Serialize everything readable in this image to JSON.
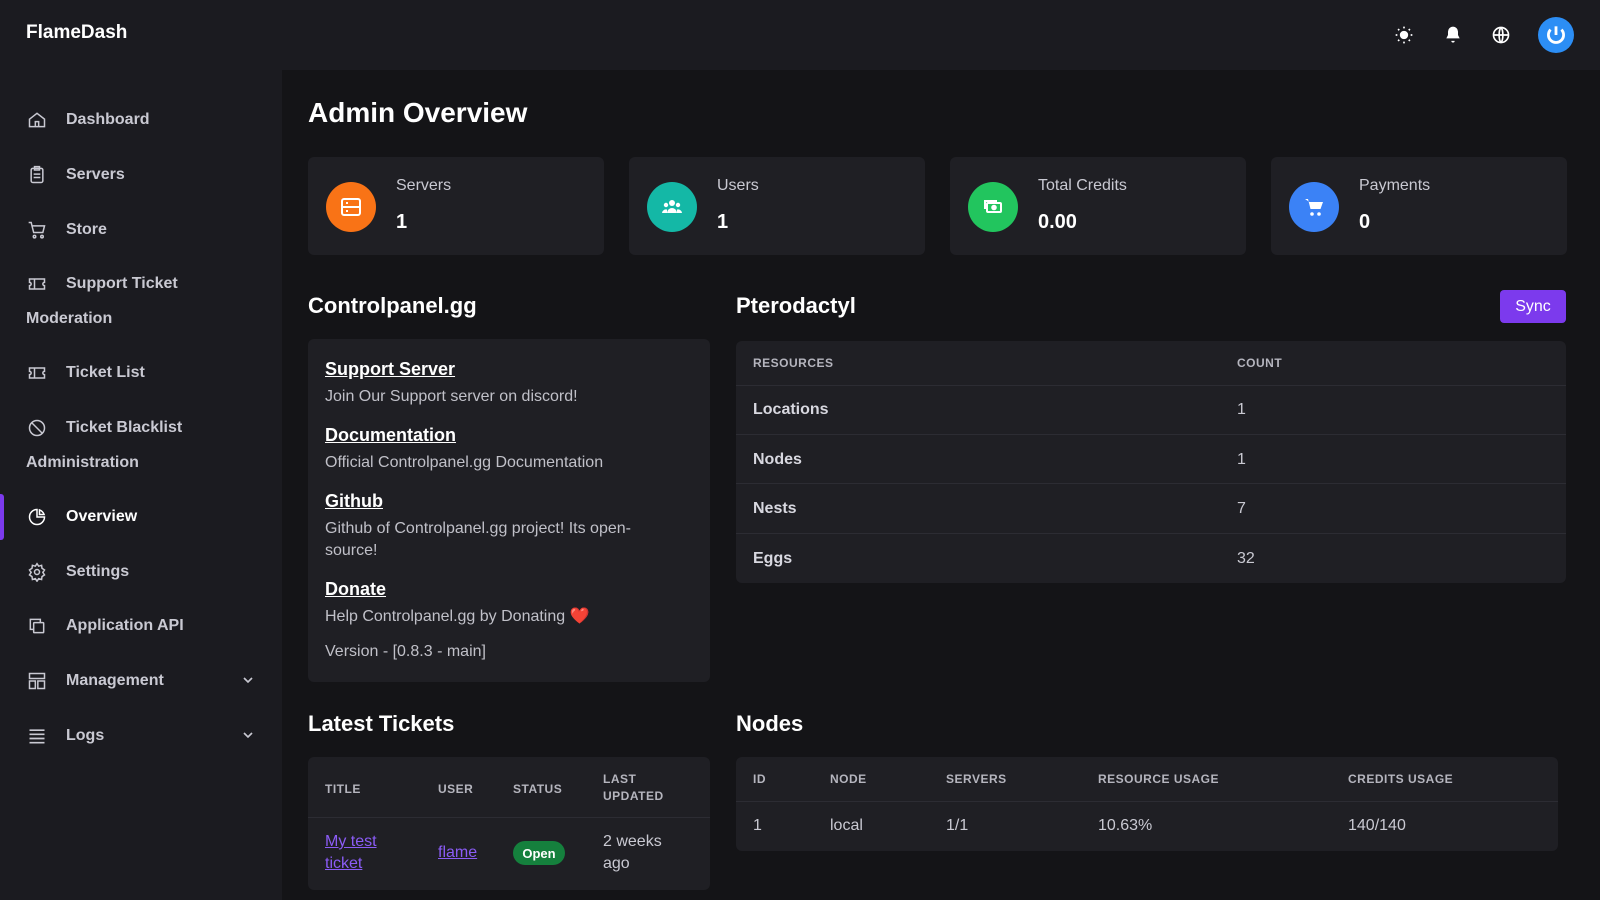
{
  "app": {
    "brand": "FlameDash"
  },
  "topbar": {
    "icons": [
      "sun-icon",
      "bell-icon",
      "globe-icon"
    ],
    "avatar_icon": "power-icon"
  },
  "sidebar": {
    "items": [
      {
        "label": "Dashboard",
        "icon": "home-icon"
      },
      {
        "label": "Servers",
        "icon": "server-icon"
      },
      {
        "label": "Store",
        "icon": "cart-icon"
      },
      {
        "label": "Support Ticket",
        "icon": "ticket-icon"
      }
    ],
    "moderation_heading": "Moderation",
    "moderation_items": [
      {
        "label": "Ticket List",
        "icon": "ticket-icon"
      },
      {
        "label": "Ticket Blacklist",
        "icon": "ban-icon"
      }
    ],
    "administration_heading": "Administration",
    "admin_items": [
      {
        "label": "Overview",
        "icon": "pie-chart-icon",
        "active": true
      },
      {
        "label": "Settings",
        "icon": "gear-icon"
      },
      {
        "label": "Application API",
        "icon": "copy-icon"
      },
      {
        "label": "Management",
        "icon": "layout-icon",
        "expandable": true
      },
      {
        "label": "Logs",
        "icon": "list-icon",
        "expandable": true
      }
    ]
  },
  "page": {
    "title": "Admin Overview"
  },
  "stats": [
    {
      "label": "Servers",
      "value": "1",
      "color": "#f97316",
      "icon": "server-icon"
    },
    {
      "label": "Users",
      "value": "1",
      "color": "#14b8a6",
      "icon": "users-icon"
    },
    {
      "label": "Total Credits",
      "value": "0.00",
      "color": "#22c55e",
      "icon": "money-icon"
    },
    {
      "label": "Payments",
      "value": "0",
      "color": "#3b82f6",
      "icon": "cart-icon"
    }
  ],
  "controlpanel": {
    "heading": "Controlpanel.gg",
    "links": [
      {
        "title": "Support Server",
        "desc": "Join Our Support server on discord!"
      },
      {
        "title": "Documentation",
        "desc": "Official Controlpanel.gg Documentation"
      },
      {
        "title": "Github",
        "desc": "Github of Controlpanel.gg project! Its open-source!"
      },
      {
        "title": "Donate",
        "desc": "Help Controlpanel.gg by Donating ❤️"
      }
    ],
    "version": "Version - [0.8.3 - main]"
  },
  "pterodactyl": {
    "heading": "Pterodactyl",
    "sync_label": "Sync",
    "columns": [
      "RESOURCES",
      "COUNT"
    ],
    "rows": [
      {
        "resource": "Locations",
        "count": "1"
      },
      {
        "resource": "Nodes",
        "count": "1"
      },
      {
        "resource": "Nests",
        "count": "7"
      },
      {
        "resource": "Eggs",
        "count": "32"
      }
    ]
  },
  "tickets": {
    "heading": "Latest Tickets",
    "columns": [
      "TITLE",
      "USER",
      "STATUS",
      "LAST",
      "UPDATED"
    ],
    "rows": [
      {
        "title_line1": "My test",
        "title_line2": "ticket",
        "user": "flame",
        "status": "Open",
        "updated_line1": "2 weeks",
        "updated_line2": "ago"
      }
    ]
  },
  "nodes": {
    "heading": "Nodes",
    "columns": [
      "ID",
      "NODE",
      "SERVERS",
      "RESOURCE USAGE",
      "CREDITS USAGE"
    ],
    "rows": [
      {
        "id": "1",
        "node": "local",
        "servers": "1/1",
        "resource_usage": "10.63%",
        "credits_usage": "140/140"
      }
    ]
  }
}
